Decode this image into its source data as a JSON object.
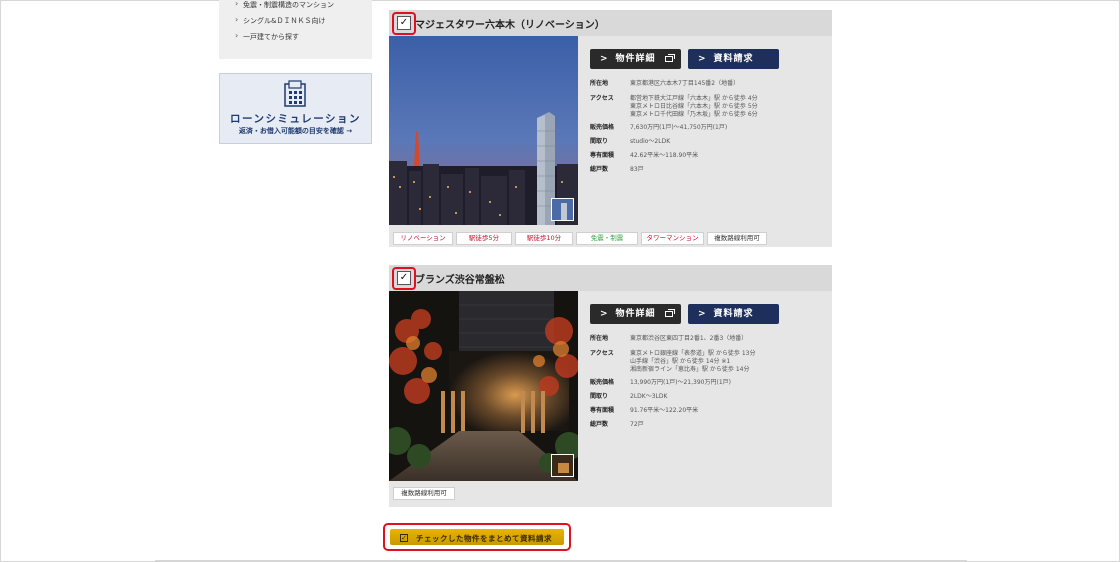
{
  "sidebar": {
    "items": [
      {
        "label": "免震・制震構造のマンション"
      },
      {
        "label": "シングル&ＤＩＮＫＳ向け"
      },
      {
        "label": "一戸建てから探す"
      }
    ]
  },
  "loan_banner": {
    "title": "ローンシミュレーション",
    "subtitle": "返済・お借入可能額の目安を確認 →"
  },
  "properties": [
    {
      "name": "マジェスタワー六本木（リノベーション）",
      "checked": "✓",
      "detail_label": "物件詳細",
      "request_label": "資料請求",
      "specs": [
        {
          "label": "所在地",
          "values": [
            "東京都港区六本木7丁目145番2（地番）"
          ]
        },
        {
          "label": "アクセス",
          "values": [
            "都営地下鉄大江戸線「六本木」駅 から徒歩 4分",
            "東京メトロ日比谷線「六本木」駅 から徒歩 5分",
            "東京メトロ千代田線「乃木坂」駅 から徒歩 6分"
          ]
        },
        {
          "label": "販売価格",
          "values": [
            "7,630万円(1戸)〜41,750万円(1戸)"
          ]
        },
        {
          "label": "間取り",
          "values": [
            "studio〜2LDK"
          ]
        },
        {
          "label": "専有面積",
          "values": [
            "42.62平米〜118.90平米"
          ]
        },
        {
          "label": "総戸数",
          "values": [
            "83戸"
          ]
        }
      ],
      "tags": [
        {
          "label": "リノベーション",
          "color": "#c8102e"
        },
        {
          "label": "駅徒歩5分",
          "color": "#c8102e"
        },
        {
          "label": "駅徒歩10分",
          "color": "#c8102e"
        },
        {
          "label": "免震・制震",
          "color": "#3aa34a"
        },
        {
          "label": "タワーマンション",
          "color": "#c8102e"
        },
        {
          "label": "複数路線利用可",
          "color": "#333333"
        }
      ]
    },
    {
      "name": "ブランズ渋谷常盤松",
      "checked": "✓",
      "detail_label": "物件詳細",
      "request_label": "資料請求",
      "specs": [
        {
          "label": "所在地",
          "values": [
            "東京都渋谷区東四丁目2番1、2番3（地番）"
          ]
        },
        {
          "label": "アクセス",
          "values": [
            "東京メトロ銀座線「表参道」駅 から徒歩 13分",
            "山手線「渋谷」駅 から徒歩 14分 ※1",
            "湘南新宿ライン「恵比寿」駅 から徒歩 14分"
          ]
        },
        {
          "label": "販売価格",
          "values": [
            "13,990万円(1戸)〜21,390万円(1戸)"
          ]
        },
        {
          "label": "間取り",
          "values": [
            "2LDK〜3LDK"
          ]
        },
        {
          "label": "専有面積",
          "values": [
            "91.76平米〜122.20平米"
          ]
        },
        {
          "label": "総戸数",
          "values": [
            "72戸"
          ]
        }
      ],
      "tags": [
        {
          "label": "複数路線利用可",
          "color": "#333333"
        }
      ]
    }
  ],
  "cta": {
    "label": "チェックした物件をまとめて資料請求",
    "icon": "checkbox-icon"
  },
  "colors": {
    "accent_navy": "#1d2f5a",
    "cta_gold": "#d8a800",
    "highlight_red": "#e01020"
  }
}
